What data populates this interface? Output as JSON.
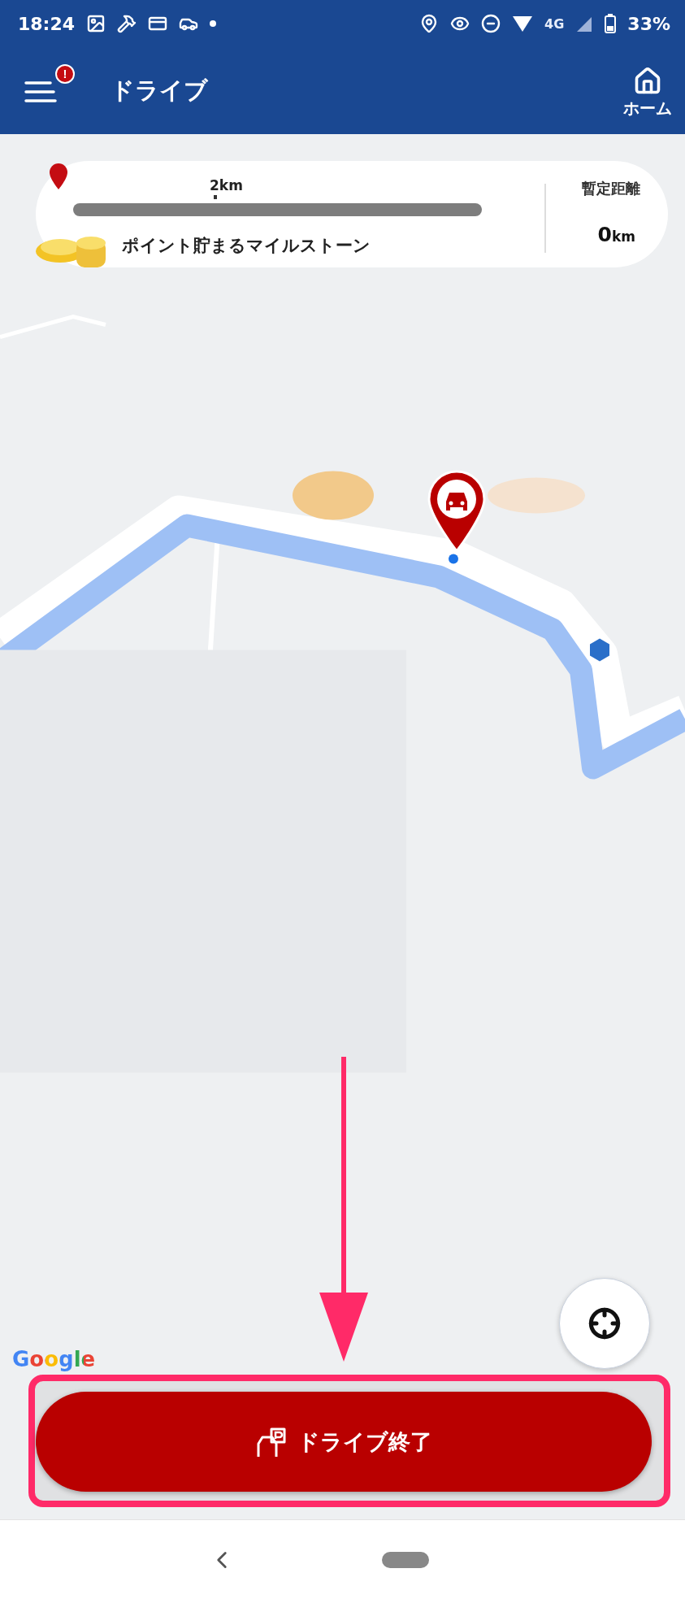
{
  "status_bar": {
    "time": "18:24",
    "network": "4G",
    "battery": "33%"
  },
  "header": {
    "menu_badge": "!",
    "title": "ドライブ",
    "home_label": "ホーム"
  },
  "milestone": {
    "marker_label": "2km",
    "level": 0,
    "title": "ポイント貯まるマイルストーン",
    "distance_label": "暫定距離",
    "distance_value": "0",
    "distance_unit": "km"
  },
  "map": {
    "kind": "picture",
    "attribution": "Google"
  },
  "end_button": {
    "label": "ドライブ終了"
  }
}
